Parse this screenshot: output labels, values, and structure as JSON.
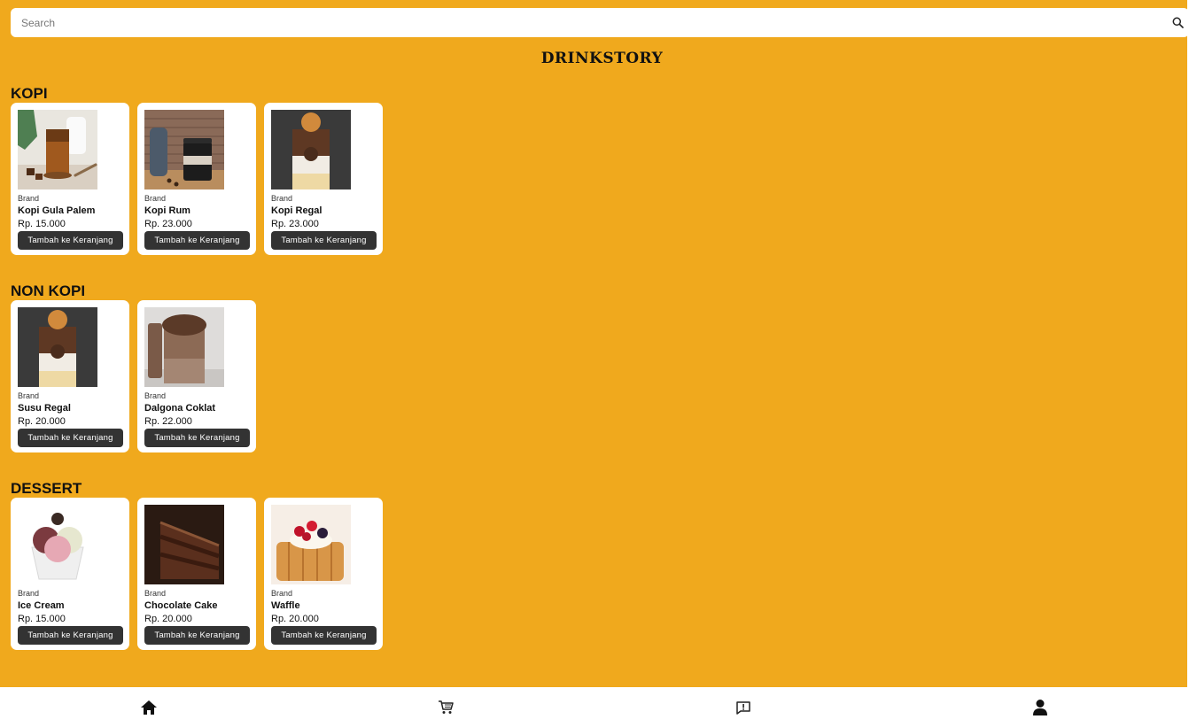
{
  "search": {
    "placeholder": "Search"
  },
  "header": {
    "title": "DRINKSTORY"
  },
  "sections": [
    {
      "title": "KOPI",
      "items": [
        {
          "brand": "Brand",
          "name": "Kopi Gula Palem",
          "price": "Rp. 15.000",
          "button": "Tambah ke Keranjang"
        },
        {
          "brand": "Brand",
          "name": "Kopi Rum",
          "price": "Rp. 23.000",
          "button": "Tambah ke Keranjang"
        },
        {
          "brand": "Brand",
          "name": "Kopi Regal",
          "price": "Rp. 23.000",
          "button": "Tambah ke Keranjang"
        }
      ]
    },
    {
      "title": "NON KOPI",
      "items": [
        {
          "brand": "Brand",
          "name": "Susu Regal",
          "price": "Rp. 20.000",
          "button": "Tambah ke Keranjang"
        },
        {
          "brand": "Brand",
          "name": "Dalgona Coklat",
          "price": "Rp. 22.000",
          "button": "Tambah ke Keranjang"
        }
      ]
    },
    {
      "title": "DESSERT",
      "items": [
        {
          "brand": "Brand",
          "name": "Ice Cream",
          "price": "Rp. 15.000",
          "button": "Tambah ke Keranjang"
        },
        {
          "brand": "Brand",
          "name": "Chocolate Cake",
          "price": "Rp. 20.000",
          "button": "Tambah ke Keranjang"
        },
        {
          "brand": "Brand",
          "name": "Waffle",
          "price": "Rp. 20.000",
          "button": "Tambah ke Keranjang"
        }
      ]
    }
  ],
  "bottom_nav": [
    {
      "icon": "home-icon"
    },
    {
      "icon": "cart-icon"
    },
    {
      "icon": "feedback-icon"
    },
    {
      "icon": "profile-icon"
    }
  ],
  "colors": {
    "background": "#f0a91d",
    "card": "#ffffff",
    "button": "#333333"
  }
}
